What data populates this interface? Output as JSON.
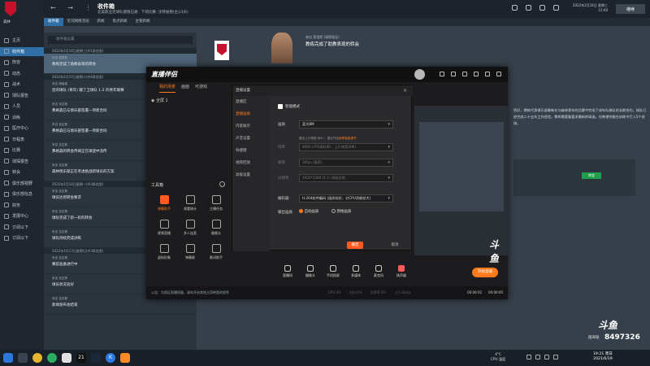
{
  "fm": {
    "club_name": "森林",
    "nav_arrows": "←  →  ⋮",
    "page_title": "收件箱",
    "page_subtitle": "北美职业足球队期限已通 · 下场比赛: 沃特福德(主)(3天)",
    "date_line1": "2022年2月16日 星期三",
    "date_line2": "15:00",
    "continue_label": "继续",
    "sidebar": [
      {
        "label": "主页",
        "active": false
      },
      {
        "label": "收件箱",
        "active": true
      },
      {
        "label": "阵容",
        "active": false
      },
      {
        "label": "动态",
        "active": false
      },
      {
        "label": "战术",
        "active": false
      },
      {
        "label": "球队报告",
        "active": false
      },
      {
        "label": "人员",
        "active": false
      },
      {
        "label": "训练",
        "active": false
      },
      {
        "label": "医疗中心",
        "active": false
      },
      {
        "label": "日程表",
        "active": false
      },
      {
        "label": "比赛",
        "active": false
      },
      {
        "label": "球探报告",
        "active": false
      },
      {
        "label": "转会",
        "active": false
      },
      {
        "label": "俱乐部视野",
        "active": false
      },
      {
        "label": "俱乐部信息",
        "active": false
      },
      {
        "label": "财务",
        "active": false
      },
      {
        "label": "发展中心",
        "active": false
      },
      {
        "label": "订阅以下",
        "active": false
      },
      {
        "label": "订阅以下",
        "active": false
      }
    ],
    "tabs": [
      "收件箱",
      "近况网络活动",
      "新闻",
      "焦点新闻",
      "主管新闻"
    ],
    "inbox_search_placeholder": "收件箱设置",
    "inbox_groups": [
      {
        "date": "2022年2月16日星期三(共1条信息)",
        "items": [
          {
            "sender": "来自 莫里斯",
            "subject": "教练完成了助教表现的转会",
            "selected": true
          }
        ]
      },
      {
        "date": "2022年2月15日星期二(共6条信息)",
        "items": [
          {
            "sender": "来自 弗格森",
            "subject": "您的球队 (青年) 输了卫球队 1-2 的青年联赛",
            "selected": false
          },
          {
            "sender": "来自 瓦拉斯",
            "subject": "弗格森已与俱乐部签署一项新合同",
            "selected": false
          },
          {
            "sender": "来自 瓦拉斯",
            "subject": "弗格森已与俱乐部签署一项新合同",
            "selected": false
          },
          {
            "sender": "来自 瓦拉斯",
            "subject": "弗格森的转会传闻正在球迷中流传",
            "selected": false
          },
          {
            "sender": "来自 瓦拉斯",
            "subject": "森林俱乐部正在考虑挑战新球员的方案",
            "selected": false
          }
        ]
      },
      {
        "date": "2022年2月14日星期一(共3条信息)",
        "items": [
          {
            "sender": "来自 瓦拉斯",
            "subject": "球员达到转会要求",
            "selected": false
          },
          {
            "sender": "来自 瓦拉斯",
            "subject": "球队完成了新一轮的转会",
            "selected": false
          },
          {
            "sender": "来自 瓦拉斯",
            "subject": "球队持续完成训练",
            "selected": false
          }
        ]
      },
      {
        "date": "2022年2月13日星期日(共3条信息)",
        "items": [
          {
            "sender": "来自 瓦拉斯",
            "subject": "赛前准备进行中",
            "selected": false
          },
          {
            "sender": "来自 瓦拉斯",
            "subject": "球员状况良好",
            "selected": false
          },
          {
            "sender": "来自 瓦拉斯",
            "subject": "新闻发布会结束",
            "selected": false
          }
        ]
      }
    ],
    "message_sender": "来自 莫里斯 (球探报告)",
    "message_subject": "教练完成了助教表现的转会",
    "message_body": "您好，教练代表俱乐部最新在与森林青年的比赛中完成了成年队梯队的长期合约。球队已经完成二十五年工作经验。教练需要看要求最新的球迷。也希望你能在训练中打入5个进球。",
    "message_button": "转会"
  },
  "live": {
    "app_title": "直播伴侣",
    "tabs": [
      "我的场景",
      "画面",
      "可游戏"
    ],
    "scene_name": "全屏 1",
    "tools_title": "工具箱",
    "tools": [
      {
        "label": "弹幕助手",
        "hot": true
      },
      {
        "label": "观看统计",
        "hot": false
      },
      {
        "label": "主播任务",
        "hot": false
      },
      {
        "label": "视频直播",
        "hot": false
      },
      {
        "label": "多人连麦",
        "hot": false
      },
      {
        "label": "摄像头",
        "hot": false
      },
      {
        "label": "虚拟形象",
        "hot": false
      },
      {
        "label": "弹幕姬",
        "hot": false
      },
      {
        "label": "歌词助手",
        "hot": false
      }
    ],
    "toolbar": [
      {
        "label": "直播间",
        "red": false
      },
      {
        "label": "摄像头",
        "red": false
      },
      {
        "label": "手机投屏",
        "red": false
      },
      {
        "label": "多媒体",
        "red": false
      },
      {
        "label": "麦克风",
        "red": false
      },
      {
        "label": "扬声器",
        "red": true
      }
    ],
    "start_button": "开始直播",
    "status_notice": "公告：为保证直播质量，请勿开启其他占用带宽的程序",
    "status_metrics": [
      "CPU:0%",
      "内存:0%",
      "丢帧率:0%",
      "上行:0kb/s"
    ],
    "status_time": [
      "00:00:02",
      "00:00:00"
    ],
    "brand_mark": "斗鱼"
  },
  "settings": {
    "title": "直播设置",
    "menu": [
      {
        "label": "直播区",
        "active": false
      },
      {
        "label": "直播画质",
        "active": true
      },
      {
        "label": "内容展示",
        "active": false
      },
      {
        "label": "声音设置",
        "active": false
      },
      {
        "label": "快捷键",
        "active": false
      },
      {
        "label": "视频回放",
        "active": false
      },
      {
        "label": "高级设置",
        "active": false
      }
    ],
    "smart_mode_label": "智能模式",
    "rows": [
      {
        "label": "画质",
        "value": "蓝光8M",
        "dim": false
      },
      {
        "label": "码率",
        "value": "8000 (FPS高码率)，上行带宽(8M)",
        "dim": true
      },
      {
        "label": "帧率",
        "value": "30fps (推荐)",
        "dim": true
      },
      {
        "label": "分辨率",
        "value": "1920*1080 (1:1) 原画比例",
        "dim": true
      },
      {
        "label": "编码器",
        "value": "H.264软件编码 (画质较好，对CPU消耗较大)",
        "dim": false
      }
    ],
    "hint_prefix": "建议上行带宽 8M+，建议开启",
    "hint_link": "帧率智能调节",
    "output_label": "输出画质",
    "radio_auto": "自动画质",
    "radio_source": "原始画质",
    "ok_label": "确定",
    "cancel_label": "取消"
  },
  "taskbar": {
    "app_21": "21",
    "app_k": "K",
    "weather_temp": "4°C",
    "weather_text": "CPU 温度",
    "time": "19:21 周日",
    "date": "2021/6/19"
  },
  "overlay": {
    "logo": "斗鱼",
    "room_label": "房间号",
    "room_number": "8497326"
  }
}
